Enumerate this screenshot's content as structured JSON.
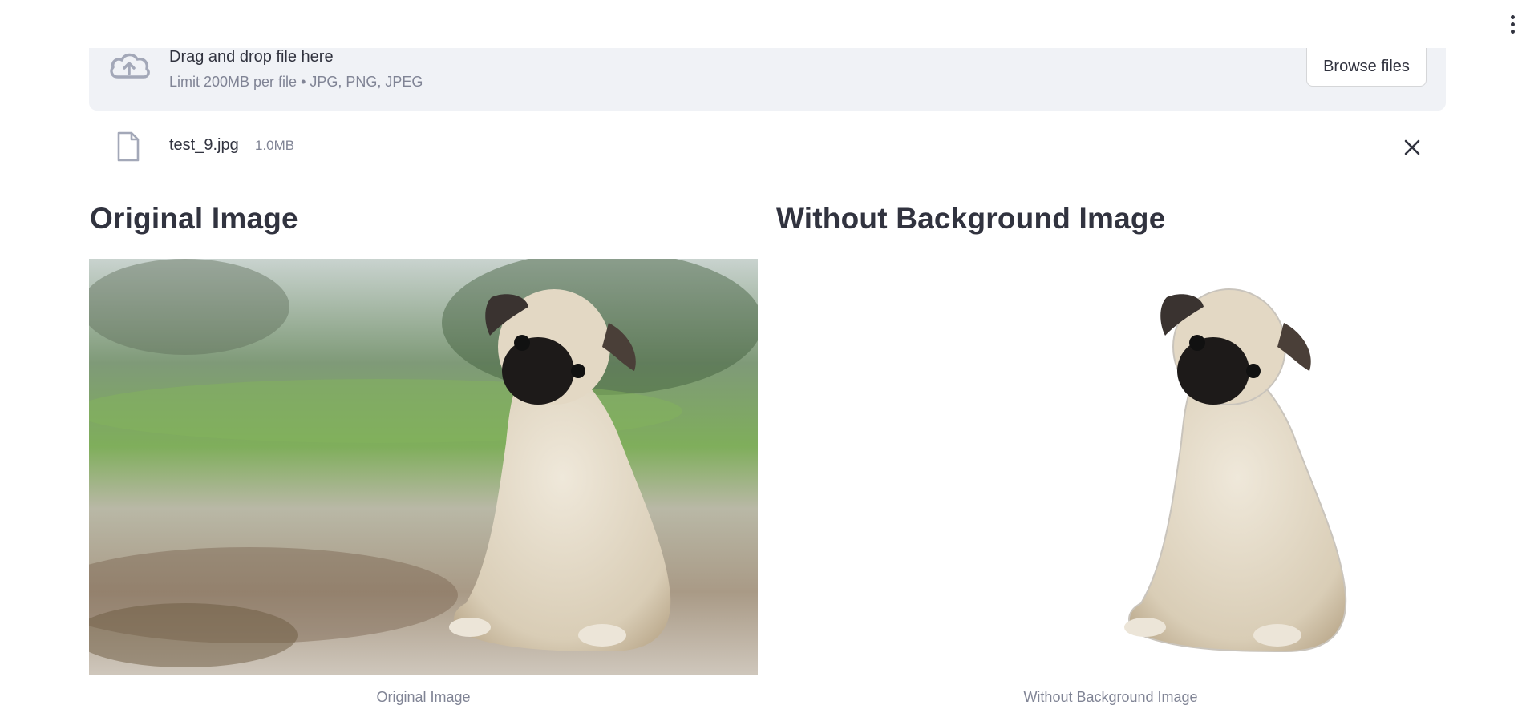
{
  "topbar": {
    "menu_icon": "more-vertical-icon"
  },
  "uploader": {
    "title": "Drag and drop file here",
    "subtitle": "Limit 200MB per file • JPG, PNG, JPEG",
    "browse_label": "Browse files",
    "icon": "cloud-upload-icon"
  },
  "file": {
    "name": "test_9.jpg",
    "size": "1.0MB",
    "icon": "file-icon",
    "remove_icon": "close-icon"
  },
  "columns": [
    {
      "title": "Original Image",
      "caption": "Original Image"
    },
    {
      "title": "Without Background Image",
      "caption": "Without Background Image"
    }
  ],
  "colors": {
    "text": "#31333f",
    "muted": "#808495",
    "dropzone_bg": "#f0f2f6"
  }
}
